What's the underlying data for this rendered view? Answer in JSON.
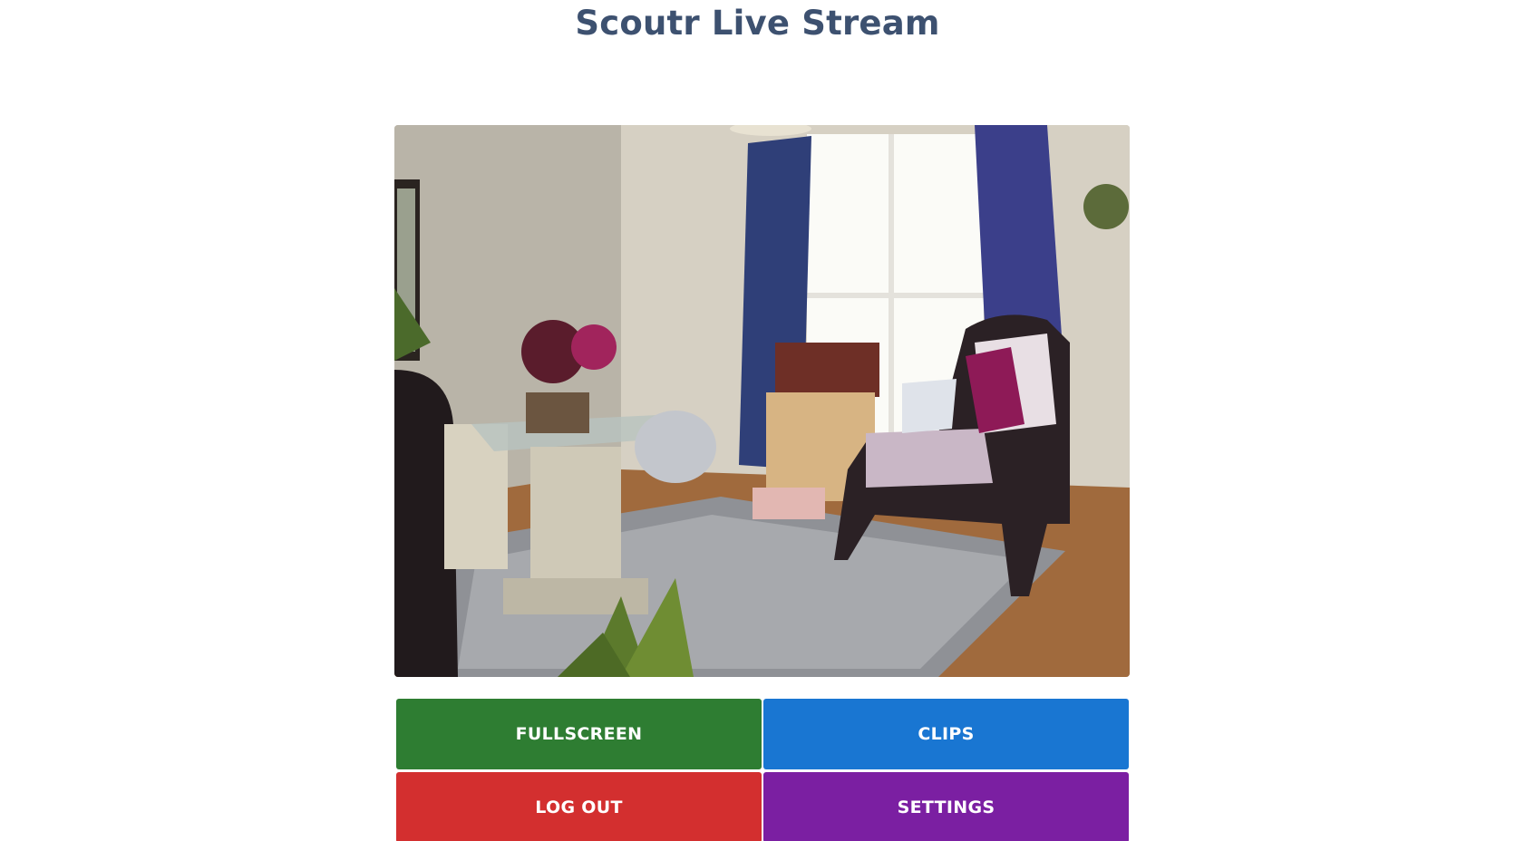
{
  "header": {
    "title": "Scoutr Live Stream"
  },
  "stream": {
    "description_icon": "camera-feed"
  },
  "buttons": {
    "fullscreen": {
      "label": "FULLSCREEN",
      "color": "#2e7d32"
    },
    "clips": {
      "label": "CLIPS",
      "color": "#1976d2"
    },
    "logout": {
      "label": "LOG OUT",
      "color": "#d32f2f"
    },
    "settings": {
      "label": "SETTINGS",
      "color": "#7b1fa2"
    }
  }
}
